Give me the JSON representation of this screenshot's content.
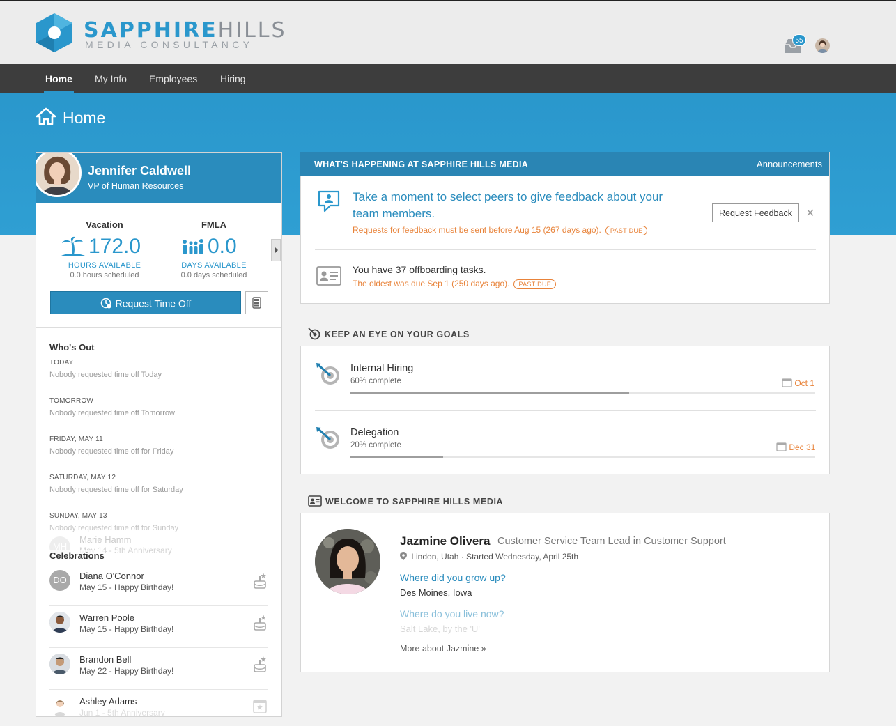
{
  "brand": {
    "name_bold": "SAPPHIRE",
    "name_light": "HILLS",
    "tagline": "MEDIA CONSULTANCY",
    "accent_color": "#2a97cc",
    "logo_icon": "hexagon-logo-icon"
  },
  "header": {
    "inbox_icon": "inbox-icon",
    "inbox_count": "55",
    "user_avatar": "user-avatar"
  },
  "nav": {
    "items": [
      {
        "label": "Home",
        "active": true
      },
      {
        "label": "My Info",
        "active": false
      },
      {
        "label": "Employees",
        "active": false
      },
      {
        "label": "Hiring",
        "active": false
      }
    ]
  },
  "page": {
    "title": "Home",
    "icon": "home-icon"
  },
  "profile": {
    "name": "Jennifer Caldwell",
    "title": "VP of Human Resources"
  },
  "balances": [
    {
      "label": "Vacation",
      "value": "172.0",
      "unit": "HOURS AVAILABLE",
      "sub": "0.0 hours scheduled",
      "icon": "palm-tree-icon"
    },
    {
      "label": "FMLA",
      "value": "0.0",
      "unit": "DAYS AVAILABLE",
      "sub": "0.0 days scheduled",
      "icon": "family-icon"
    }
  ],
  "time_off": {
    "request_label": "Request Time Off",
    "request_icon": "clock-request-icon",
    "calculator_icon": "calculator-icon"
  },
  "whos_out": {
    "title": "Who's Out",
    "days": [
      {
        "day": "TODAY",
        "note": "Nobody requested time off Today"
      },
      {
        "day": "TOMORROW",
        "note": "Nobody requested time off Tomorrow"
      },
      {
        "day": "FRIDAY, MAY 11",
        "note": "Nobody requested time off for Friday"
      },
      {
        "day": "SATURDAY, MAY 12",
        "note": "Nobody requested time off for Saturday"
      },
      {
        "day": "SUNDAY, MAY 13",
        "note": "Nobody requested time off for Sunday"
      }
    ]
  },
  "celebrations": {
    "title": "Celebrations",
    "faded_top": {
      "initials": "MH",
      "name": "Marie Hamm",
      "sub": "May 14 - 5th Anniversary"
    },
    "items": [
      {
        "initials": "DO",
        "name": "Diana O'Connor",
        "sub": "May 15 - Happy Birthday!"
      },
      {
        "initials": "",
        "name": "Warren Poole",
        "sub": "May 15 - Happy Birthday!"
      },
      {
        "initials": "",
        "name": "Brandon Bell",
        "sub": "May 22 - Happy Birthday!"
      },
      {
        "initials": "",
        "name": "Ashley Adams",
        "sub": "Jun 1 - 5th Anniversary"
      }
    ]
  },
  "happening": {
    "title": "WHAT'S HAPPENING AT SAPPHIRE HILLS MEDIA",
    "link": "Announcements",
    "feedback": {
      "message": "Take a moment to select peers to give feedback about your team members.",
      "sub": "Requests for feedback must be sent before Aug 15 (267 days ago).",
      "badge": "PAST DUE",
      "button": "Request Feedback",
      "close": "×"
    },
    "offboarding": {
      "message": "You have 37 offboarding tasks.",
      "sub": "The oldest was due Sep 1 (250 days ago).",
      "badge": "PAST DUE"
    }
  },
  "goals": {
    "title": "KEEP AN EYE ON YOUR GOALS",
    "items": [
      {
        "name": "Internal Hiring",
        "pct_label": "60% complete",
        "progress": 0.6,
        "due": "Oct 1"
      },
      {
        "name": "Delegation",
        "pct_label": "20% complete",
        "progress": 0.2,
        "due": "Dec 31"
      }
    ]
  },
  "welcome": {
    "title": "WELCOME TO SAPPHIRE HILLS MEDIA",
    "name": "Jazmine Olivera",
    "role": "Customer Service Team Lead in Customer Support",
    "location": "Lindon, Utah · Started Wednesday, April 25th",
    "q1": "Where did you grow up?",
    "a1": "Des Moines, Iowa",
    "q2": "Where do you live now?",
    "a2": "Salt Lake, by the 'U'",
    "more": "More about Jazmine »"
  }
}
